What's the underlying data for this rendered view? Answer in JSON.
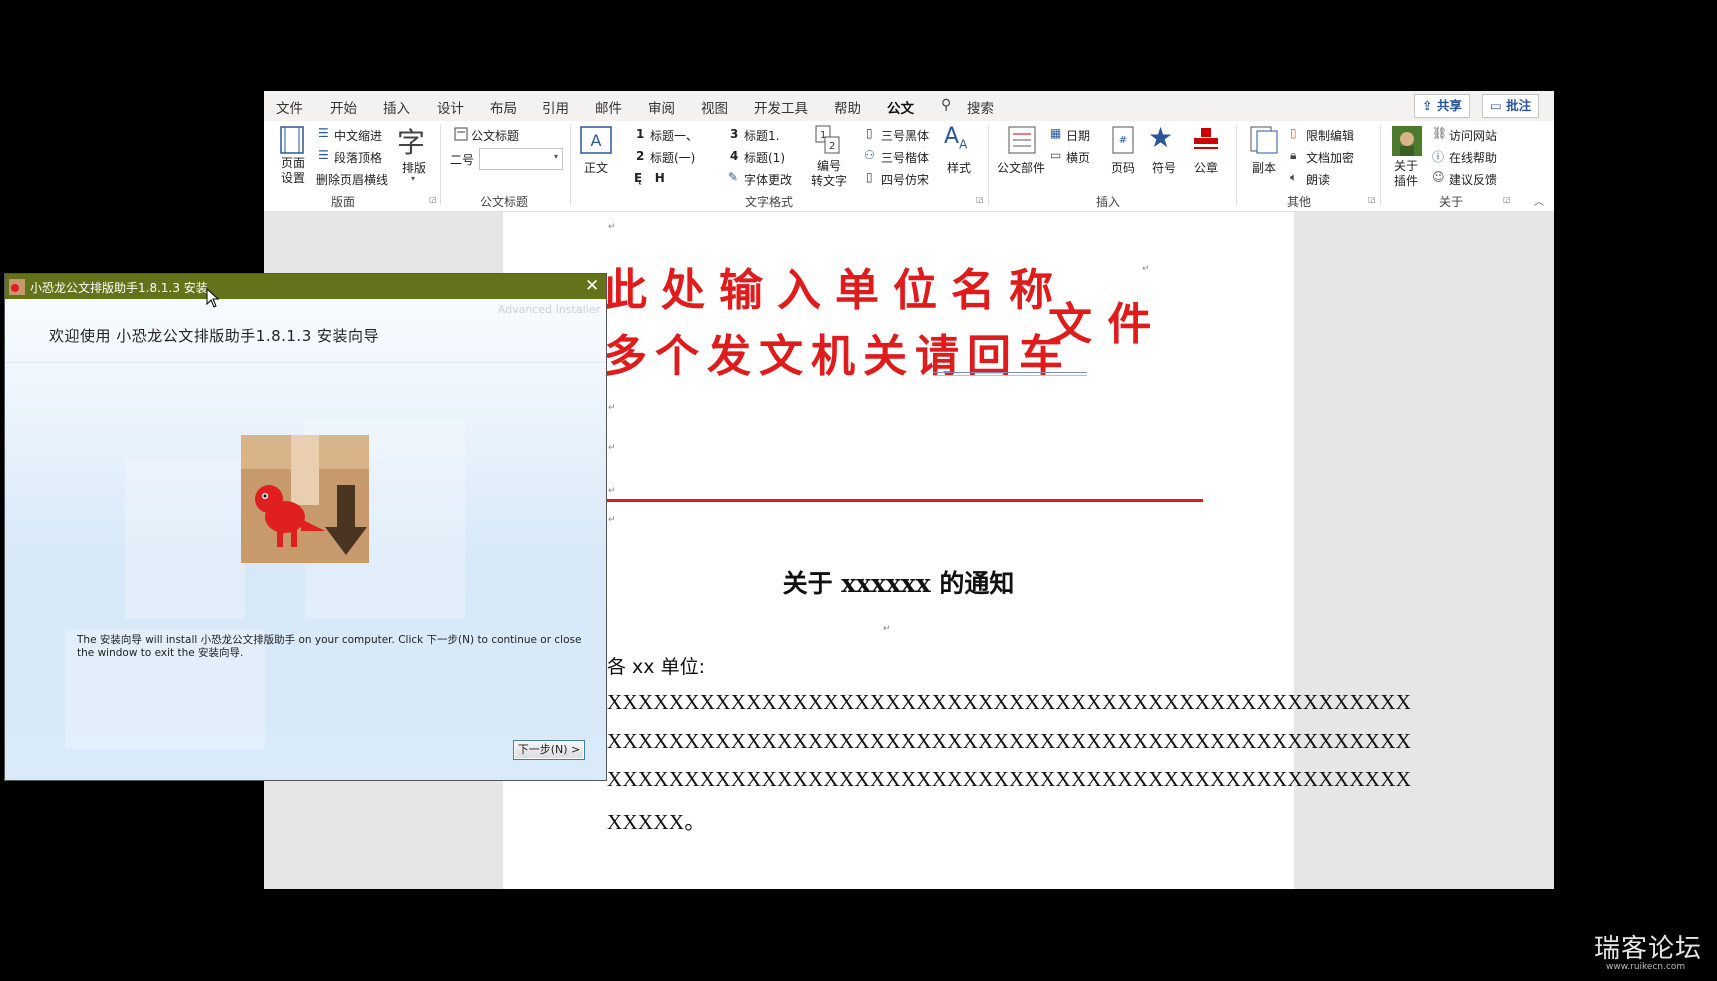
{
  "word": {
    "menu_tabs": [
      "文件",
      "开始",
      "插入",
      "设计",
      "布局",
      "引用",
      "邮件",
      "审阅",
      "视图",
      "开发工具",
      "帮助",
      "公文"
    ],
    "search_label": "搜索",
    "share_label": "共享",
    "comment_label": "批注",
    "ribbon": {
      "banmian": {
        "page_setup": "页面\n设置",
        "zh_indent": "中文缩进",
        "para_top": "段落顶格",
        "del_header_line": "删除页眉横线",
        "paiban": "排版",
        "group": "版面"
      },
      "gongwen_title": {
        "item": "公文标题",
        "size_label": "二号",
        "group": "公文标题"
      },
      "text_format": {
        "zhengwen": "正文",
        "h1": "标题一、",
        "h2": "标题(一)",
        "h3": "标题1.",
        "h4": "标题(1)",
        "font_change": "字体更改",
        "renumber": "编号\n转文字",
        "f1": "三号黑体",
        "f2": "三号楷体",
        "f3": "四号仿宋",
        "style": "样式",
        "group": "文字格式"
      },
      "insert": {
        "parts": "公文部件",
        "date": "日期",
        "landscape": "横页",
        "page_num": "页码",
        "symbol": "符号",
        "seal": "公章",
        "group": "插入"
      },
      "other": {
        "copy": "副本",
        "restrict": "限制编辑",
        "encrypt": "文档加密",
        "read": "朗读",
        "group": "其他"
      },
      "about": {
        "plugin": "关于\n插件",
        "website": "访问网站",
        "help": "在线帮助",
        "feedback": "建议反馈",
        "group": "关于"
      }
    },
    "document": {
      "org_line1": "此处输入单位名称",
      "org_line2": "多个发文机关请回车",
      "doc_word": "文 件",
      "notice_title": "关于 xxxxxx 的通知",
      "addressee": "各 xx 单位:",
      "body_lines": [
        "XXXXXXXXXXXXXXXXXXXXXXXXXXXXXXXXXXXXXXXXXXXXXXXXXXXX",
        "XXXXXXXXXXXXXXXXXXXXXXXXXXXXXXXXXXXXXXXXXXXXXXXXXXXX",
        "XXXXXXXXXXXXXXXXXXXXXXXXXXXXXXXXXXXXXXXXXXXXXXXXXXXX",
        "XXXXX。"
      ]
    }
  },
  "installer": {
    "title": "小恐龙公文排版助手1.8.1.3 安装",
    "brand": "Advanced Installer",
    "heading": "欢迎使用 小恐龙公文排版助手1.8.1.3 安装向导",
    "description_line1": "The 安装向导 will install 小恐龙公文排版助手 on your computer. Click 下一步(N) to continue or close",
    "description_line2": "the window to exit the 安装向导.",
    "next_button": "下一步(N) >"
  },
  "watermark": {
    "main": "瑞客论坛",
    "sub": "www.ruikecn.com"
  },
  "colors": {
    "accent": "#2b579a",
    "title_red": "#e01b1b",
    "dialog_titlebar": "#64731b"
  }
}
